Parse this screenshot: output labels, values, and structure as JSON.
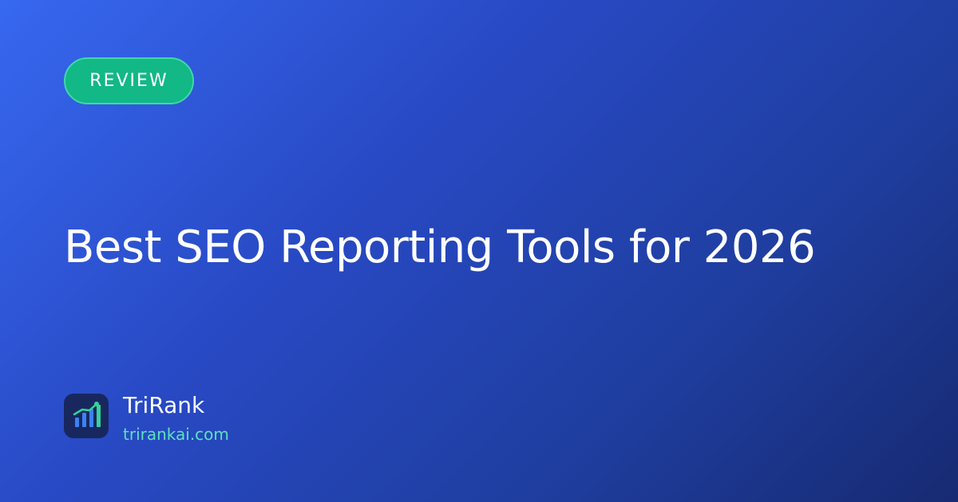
{
  "badge": {
    "label": "REVIEW"
  },
  "headline": {
    "title": "Best SEO Reporting Tools for 2026"
  },
  "brand": {
    "name": "TriRank",
    "url": "trirankai.com"
  },
  "colors": {
    "background_start": "#3768f0",
    "background_end": "#172a72",
    "badge_bg": "#12b886",
    "brand_url": "#5de0c0",
    "logo_bg": "#18285e"
  },
  "icons": {
    "logo": "bar-chart-growth-icon"
  }
}
